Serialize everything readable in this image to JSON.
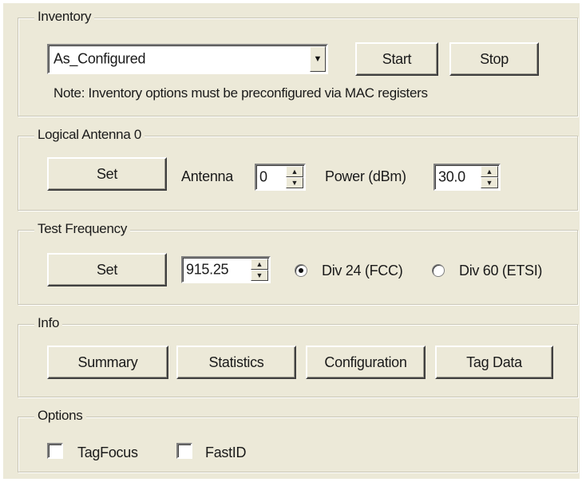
{
  "inventory": {
    "legend": "Inventory",
    "mode_value": "As_Configured",
    "start_label": "Start",
    "stop_label": "Stop",
    "note": "Note: Inventory options must be preconfigured via MAC registers"
  },
  "logical_antenna": {
    "legend": "Logical Antenna 0",
    "set_label": "Set",
    "antenna_label": "Antenna",
    "antenna_value": "0",
    "power_label": "Power (dBm)",
    "power_value": "30.0"
  },
  "test_frequency": {
    "legend": "Test Frequency",
    "set_label": "Set",
    "frequency_value": "915.25",
    "option_fcc": "Div 24 (FCC)",
    "option_etsi": "Div 60 (ETSI)",
    "selected": "fcc"
  },
  "info": {
    "legend": "Info",
    "summary_label": "Summary",
    "statistics_label": "Statistics",
    "configuration_label": "Configuration",
    "tag_data_label": "Tag Data"
  },
  "options": {
    "legend": "Options",
    "tagfocus_label": "TagFocus",
    "tagfocus_checked": false,
    "fastid_label": "FastID",
    "fastid_checked": false
  },
  "icons": {
    "dropdown_arrow": "chevron-down-icon",
    "spin_up": "spin-up-icon",
    "spin_down": "spin-down-icon"
  },
  "colors": {
    "panel_bg": "#ece9d8",
    "field_bg": "#ffffff"
  }
}
